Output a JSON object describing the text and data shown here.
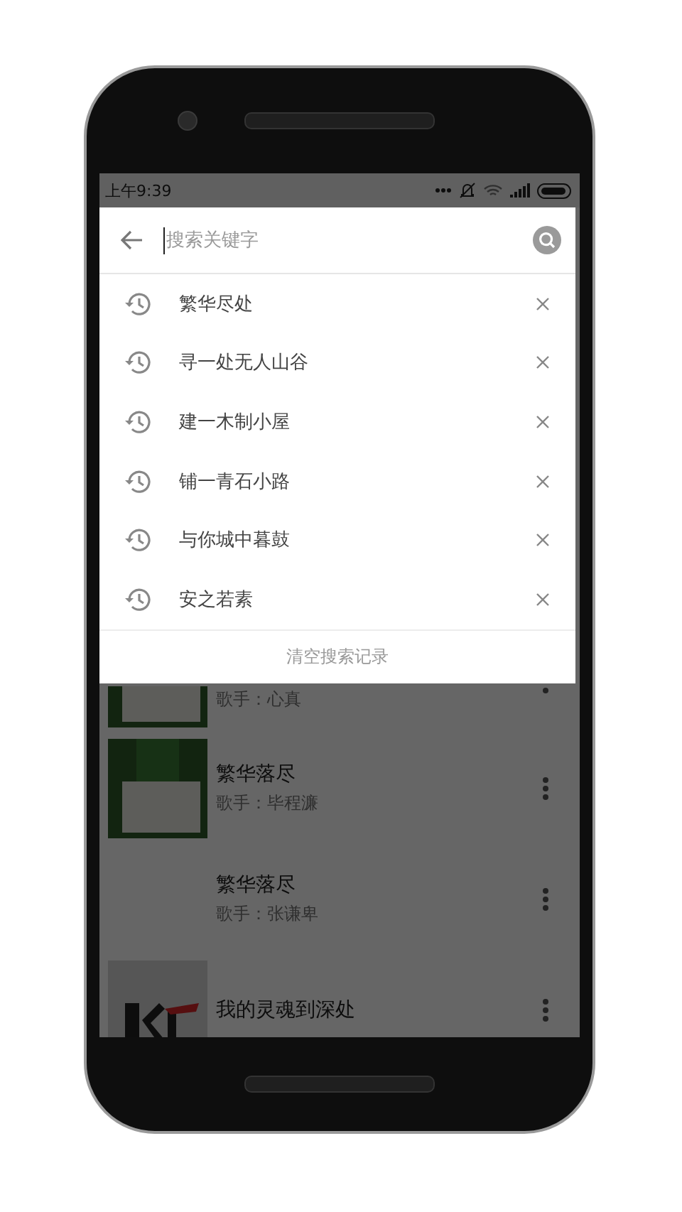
{
  "status_bar": {
    "time": "上午9:39"
  },
  "search": {
    "placeholder": "搜索关键字"
  },
  "history": [
    {
      "text": "繁华尽处"
    },
    {
      "text": "寻一处无人山谷"
    },
    {
      "text": "建一木制小屋"
    },
    {
      "text": "铺一青石小路"
    },
    {
      "text": "与你城中暮鼓"
    },
    {
      "text": "安之若素"
    }
  ],
  "clear_history": "清空搜索记录",
  "songs": [
    {
      "artist": "歌手：心真",
      "picture": true
    },
    {
      "title": "繁华落尽",
      "artist": "歌手：毕程濂",
      "picture": true
    },
    {
      "title": "繁华落尽",
      "artist": "歌手：张谦卑",
      "picture": false
    },
    {
      "title": "我的灵魂到深处",
      "picture": true
    }
  ]
}
